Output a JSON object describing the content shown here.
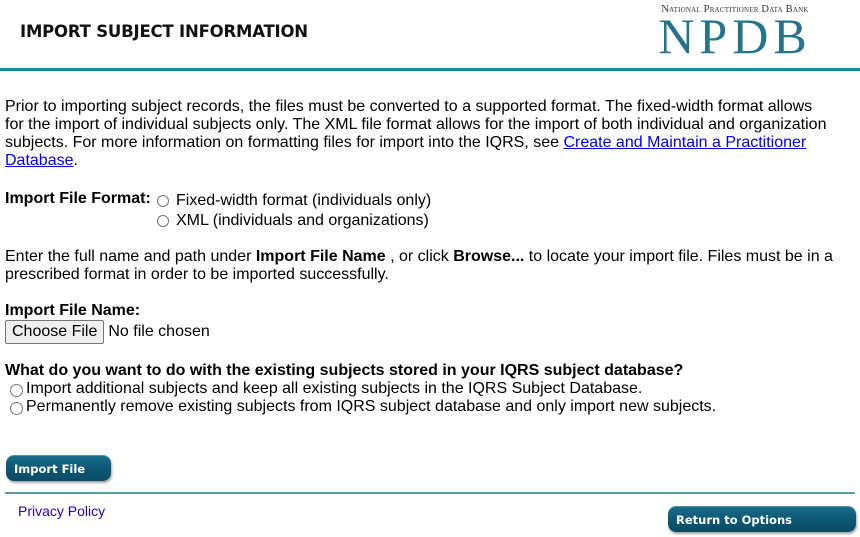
{
  "header": {
    "title": "IMPORT SUBJECT INFORMATION",
    "logo_subtitle": "National Practitioner Data Bank",
    "logo_main": "NPDB"
  },
  "intro": {
    "text_before_link": "Prior to importing subject records, the files must be converted to a supported format. The fixed-width format allows for the import of individual subjects only. The XML file format allows for the import of both individual and organization subjects. For more information on formatting files for import into the IQRS, see ",
    "link_text": "Create and Maintain a Practitioner Database",
    "text_after_link": "."
  },
  "import_format": {
    "label": "Import File Format:",
    "options": [
      {
        "label": "Fixed-width format (individuals only)",
        "selected": false
      },
      {
        "label": "XML (individuals and organizations)",
        "selected": false
      }
    ]
  },
  "instructions": {
    "part1": "Enter the full name and path under ",
    "bold1": "Import File Name",
    "part2": " , or click ",
    "bold2": "Browse...",
    "part3": " to locate your import file. Files must be in a prescribed format in order to be imported successfully."
  },
  "file_input": {
    "label": "Import File Name:",
    "button_label": "Choose File",
    "status": "No file chosen"
  },
  "existing_subjects": {
    "question": "What do you want to do with the existing subjects stored in your IQRS subject database?",
    "options": [
      {
        "label": "Import additional subjects and keep all existing subjects in the IQRS Subject Database.",
        "selected": false
      },
      {
        "label": "Permanently remove existing subjects from IQRS subject database and only import new subjects.",
        "selected": false
      }
    ]
  },
  "actions": {
    "import_label": "Import File",
    "return_label": "Return to Options"
  },
  "footer": {
    "privacy_label": "Privacy Policy"
  },
  "colors": {
    "accent_teal": "#138a9a",
    "logo_blue": "#23748f",
    "button_dark": "#0f5a78",
    "link": "#0000ee"
  }
}
